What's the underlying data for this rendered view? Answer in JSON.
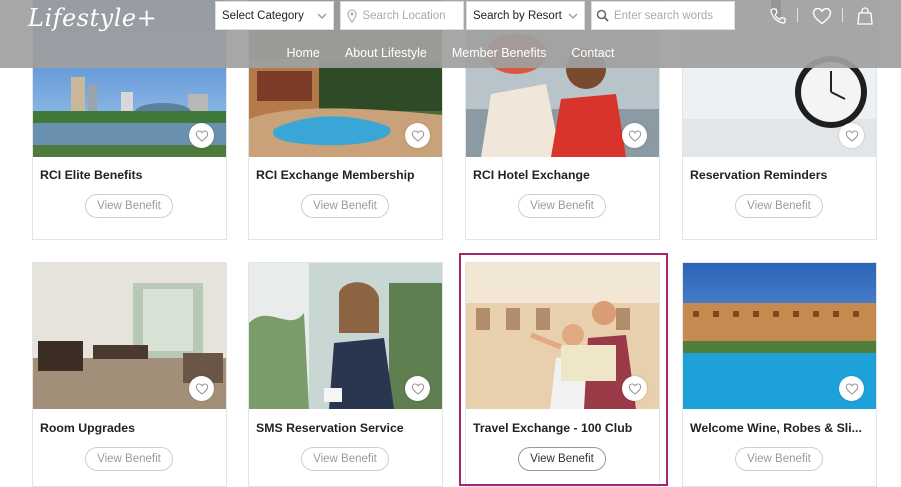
{
  "header": {
    "logo": "Lifestyle+",
    "category_select": "Select Category",
    "location_placeholder": "Search Location",
    "resort_select": "Search by Resort",
    "keyword_placeholder": "Enter search words",
    "icons": [
      "phone-icon",
      "heart-icon",
      "shopping-bag-icon"
    ]
  },
  "nav": {
    "items": [
      "Home",
      "About Lifestyle",
      "Member Benefits",
      "Contact"
    ]
  },
  "cards": [
    {
      "title": "RCI Elite Benefits",
      "button": "View Benefit"
    },
    {
      "title": "RCI Exchange Membership",
      "button": "View Benefit"
    },
    {
      "title": "RCI Hotel Exchange",
      "button": "View Benefit"
    },
    {
      "title": "Reservation Reminders",
      "button": "View Benefit"
    },
    {
      "title": "Room Upgrades",
      "button": "View Benefit"
    },
    {
      "title": "SMS Reservation Service",
      "button": "View Benefit"
    },
    {
      "title": "Travel Exchange - 100 Club",
      "button": "View Benefit"
    },
    {
      "title": "Welcome Wine, Robes & Sli...",
      "button": "View Benefit"
    }
  ],
  "colors": {
    "header_bg": "#a0a0a0",
    "highlight_border": "#a3266f"
  }
}
